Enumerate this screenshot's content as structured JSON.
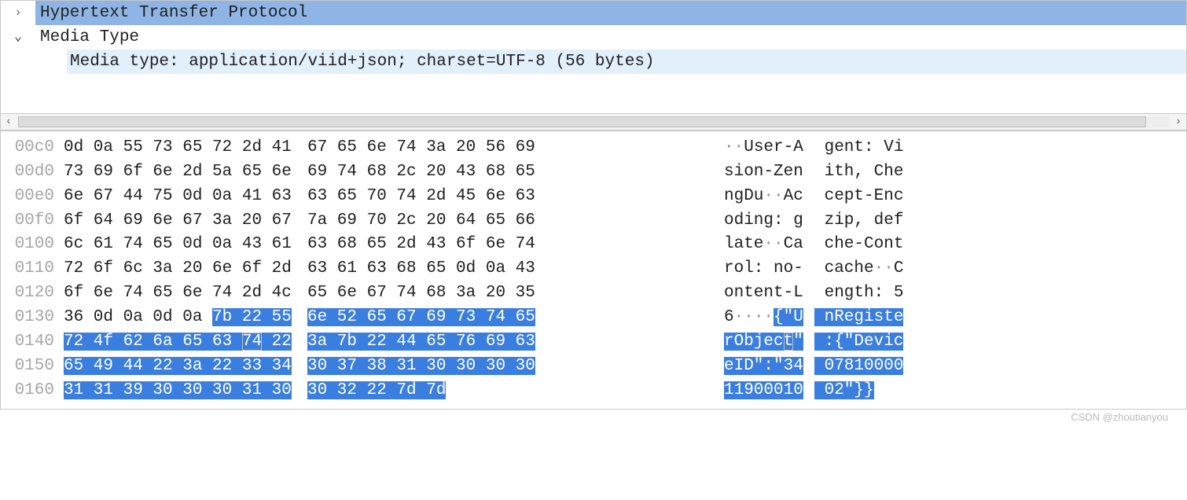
{
  "tree": {
    "http_label": "Hypertext Transfer Protocol",
    "media_label": "Media Type",
    "media_detail": "Media type: application/viid+json; charset=UTF-8 (56 bytes)"
  },
  "hexdump": {
    "rows": [
      {
        "addr": "00c0",
        "hex1_plain": "0d 0a 55 73 65 72 2d 41",
        "hex2_plain": "67 65 6e 74 3a 20 56 69",
        "asc1_pre_dot": "",
        "asc1_dots": "··",
        "asc1_post_dot": "User-A",
        "asc2_plain": " gent: Vi"
      },
      {
        "addr": "00d0",
        "hex1_plain": "73 69 6f 6e 2d 5a 65 6e",
        "hex2_plain": "69 74 68 2c 20 43 68 65",
        "asc1_plain": "sion-Zen",
        "asc2_plain": " ith, Che"
      },
      {
        "addr": "00e0",
        "hex1_plain": "6e 67 44 75 0d 0a 41 63",
        "hex2_plain": "63 65 70 74 2d 45 6e 63",
        "asc1_pre_dot": "ngDu",
        "asc1_dots": "··",
        "asc1_post_dot": "Ac",
        "asc2_plain": " cept-Enc"
      },
      {
        "addr": "00f0",
        "hex1_plain": "6f 64 69 6e 67 3a 20 67",
        "hex2_plain": "7a 69 70 2c 20 64 65 66",
        "asc1_plain": "oding: g",
        "asc2_plain": " zip, def"
      },
      {
        "addr": "0100",
        "hex1_plain": "6c 61 74 65 0d 0a 43 61",
        "hex2_plain": "63 68 65 2d 43 6f 6e 74",
        "asc1_pre_dot": "late",
        "asc1_dots": "··",
        "asc1_post_dot": "Ca",
        "asc2_plain": " che-Cont"
      },
      {
        "addr": "0110",
        "hex1_plain": "72 6f 6c 3a 20 6e 6f 2d",
        "hex2_plain": "63 61 63 68 65 0d 0a 43",
        "asc1_plain": "rol: no-",
        "asc2_pre_dot": " cache",
        "asc2_dots": "··",
        "asc2_post_dot": "C"
      },
      {
        "addr": "0120",
        "hex1_plain": "6f 6e 74 65 6e 74 2d 4c",
        "hex2_plain": "65 6e 67 74 68 3a 20 35",
        "asc1_plain": "ontent-L",
        "asc2_plain": " ength: 5"
      },
      {
        "addr": "0130",
        "hex1_plain_prefix": "36 0d 0a 0d 0a ",
        "hex1_sel": "7b 22 55",
        "hex2_sel": "6e 52 65 67 69 73 74 65",
        "asc1_pre_dot": "6",
        "asc1_dots": "····",
        "asc1_sel": "{\"U",
        "asc2_sel": " nRegiste"
      },
      {
        "addr": "0140",
        "hex1_sel_a": "72 4f 62 6a 65 63 ",
        "hex1_sel_boxed": "74",
        "hex1_sel_c": " 22",
        "hex2_sel": "3a 7b 22 44 65 76 69 63",
        "asc1_sel_a": "rObjec",
        "asc1_sel_boxed": "t",
        "asc1_sel_c": "\"",
        "asc2_sel": " :{\"Devic"
      },
      {
        "addr": "0150",
        "hex1_sel": "65 49 44 22 3a 22 33 34",
        "hex2_sel": "30 37 38 31 30 30 30 30",
        "asc1_sel": "eID\":\"34",
        "asc2_sel": " 07810000"
      },
      {
        "addr": "0160",
        "hex1_sel": "31 31 39 30 30 30 31 30",
        "hex2_sel": "30 32 22 7d 7d",
        "asc1_sel": "11900010",
        "asc2_sel": " 02\"}}"
      }
    ]
  },
  "watermark": "CSDN @zhoutianyou"
}
